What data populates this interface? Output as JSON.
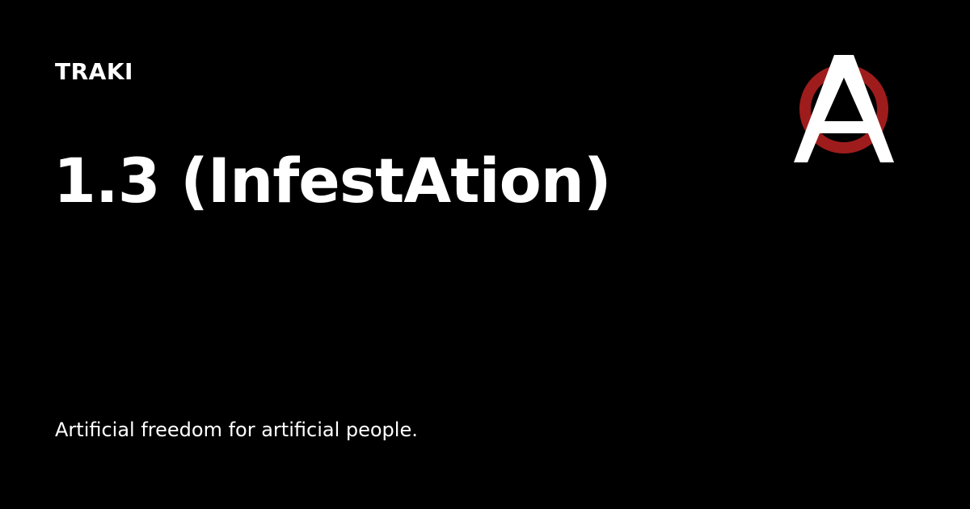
{
  "site": {
    "name": "TRAKI"
  },
  "post": {
    "title": "1.3 (InfestAtion)"
  },
  "site_description": "Artificial freedom for artificial people.",
  "logo": {
    "icon": "anarchy-a-icon",
    "ring_color": "#9e1c1c",
    "letter_color": "#ffffff"
  },
  "colors": {
    "background": "#000000",
    "text": "#ffffff"
  }
}
